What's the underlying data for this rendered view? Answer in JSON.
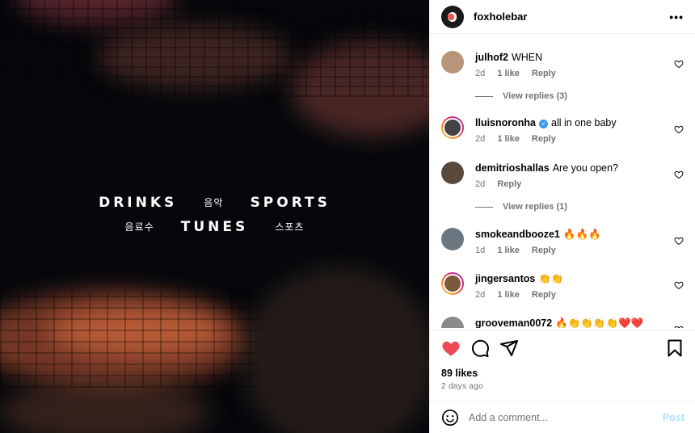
{
  "media": {
    "row1": [
      "DRINKS",
      "음악",
      "SPORTS"
    ],
    "row2": [
      "음료수",
      "TUNES",
      "스포츠"
    ]
  },
  "header": {
    "username": "foxholebar",
    "more_label": "•••"
  },
  "comments": [
    {
      "user": "julhof2",
      "text": "WHEN",
      "time": "2d",
      "likes": "1 like",
      "reply": "Reply",
      "view_replies": "View replies (3)",
      "avatar_color": "#b8957a",
      "ring": false,
      "verified": false
    },
    {
      "user": "lluisnoronha",
      "text": "all in one baby",
      "time": "2d",
      "likes": "1 like",
      "reply": "Reply",
      "view_replies": null,
      "avatar_color": "#444444",
      "ring": true,
      "verified": true
    },
    {
      "user": "demitrioshallas",
      "text": "Are you open?",
      "time": "2d",
      "likes": null,
      "reply": "Reply",
      "view_replies": "View replies (1)",
      "avatar_color": "#5a4a3e",
      "ring": false,
      "verified": false
    },
    {
      "user": "smokeandbooze1",
      "text": "🔥🔥🔥",
      "time": "1d",
      "likes": "1 like",
      "reply": "Reply",
      "view_replies": null,
      "avatar_color": "#6a7680",
      "ring": false,
      "verified": false
    },
    {
      "user": "jingersantos",
      "text": "👏👏",
      "time": "2d",
      "likes": "1 like",
      "reply": "Reply",
      "view_replies": null,
      "avatar_color": "#7a5a3a",
      "ring": true,
      "verified": false
    },
    {
      "user": "grooveman0072",
      "text": "🔥👏👏👏👏❤️❤️",
      "time": "",
      "likes": null,
      "reply": "",
      "view_replies": null,
      "avatar_color": "#8a8a8a",
      "ring": false,
      "verified": false
    }
  ],
  "actions": {
    "likes": "89 likes",
    "date": "2 days ago"
  },
  "add_comment": {
    "placeholder": "Add a comment...",
    "post_label": "Post"
  },
  "colors": {
    "like_red": "#ed4956",
    "post_blue_disabled": "#b2dffc",
    "meta_gray": "#737373"
  }
}
